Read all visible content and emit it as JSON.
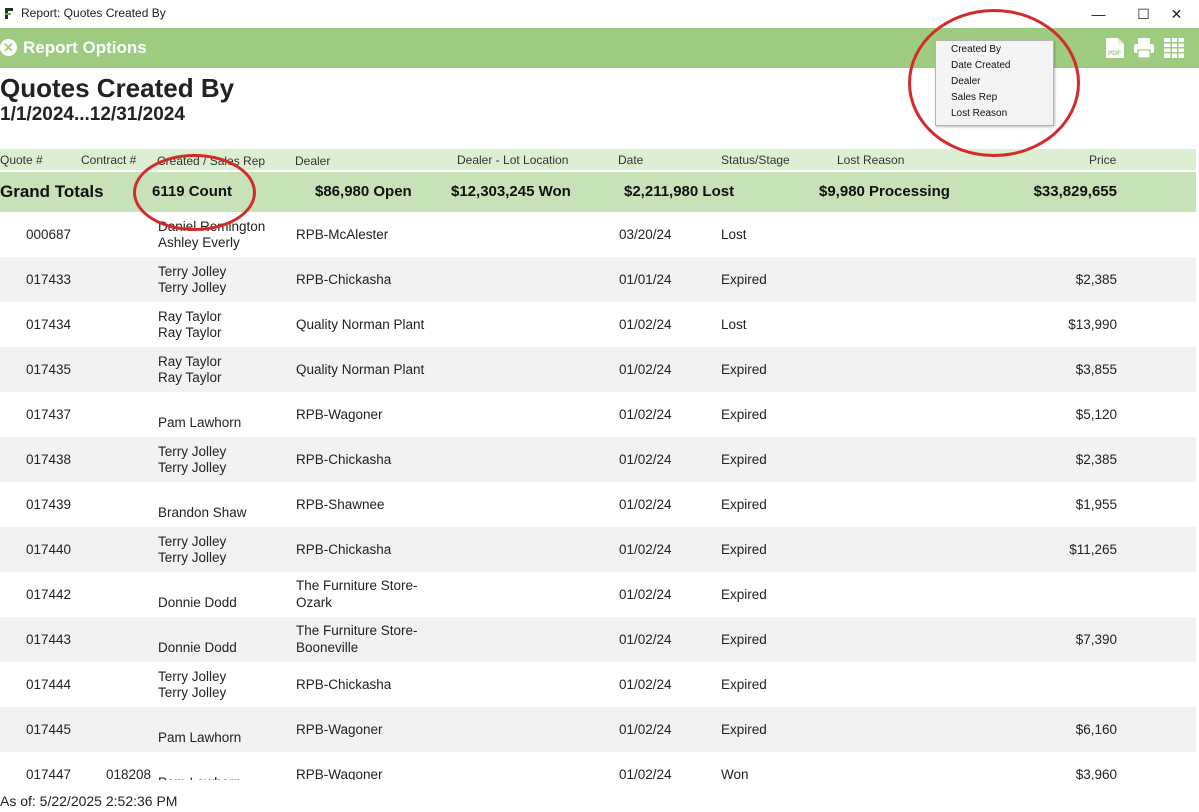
{
  "window": {
    "title": "Report: Quotes Created By",
    "minimize_glyph": "—",
    "maximize_glyph": "☐",
    "close_glyph": "✕"
  },
  "ribbon": {
    "close_glyph": "✕",
    "label": "Report Options",
    "icons": [
      "pdf-icon",
      "print-icon",
      "grid-icon"
    ],
    "pdf_text": "PDF"
  },
  "report": {
    "title": "Quotes Created By",
    "date_range": "1/1/2024...12/31/2024"
  },
  "columns": {
    "quote": "Quote #",
    "contract": "Contract #",
    "created": "Created / Sales Rep",
    "dealer": "Dealer",
    "lot": "Dealer - Lot Location",
    "date": "Date",
    "status": "Status/Stage",
    "lost": "Lost Reason",
    "price": "Price"
  },
  "totals": {
    "label": "Grand Totals",
    "count": "6119 Count",
    "open": "$86,980 Open",
    "won": "$12,303,245 Won",
    "lost": "$2,211,980  Lost",
    "processing": "$9,980 Processing",
    "price": "$33,829,655"
  },
  "rows": [
    {
      "quote": "000687",
      "contract": "",
      "created": "Daniel Remington",
      "rep": "Ashley Everly",
      "dealer": "RPB-McAlester",
      "dealer2": "",
      "date": "03/20/24",
      "status": "Lost",
      "price": ""
    },
    {
      "quote": "017433",
      "contract": "",
      "created": "Terry  Jolley",
      "rep": "Terry  Jolley",
      "dealer": "RPB-Chickasha",
      "dealer2": "",
      "date": "01/01/24",
      "status": "Expired",
      "price": "$2,385"
    },
    {
      "quote": "017434",
      "contract": "",
      "created": "Ray Taylor",
      "rep": "Ray Taylor",
      "dealer": "Quality Norman Plant",
      "dealer2": "",
      "date": "01/02/24",
      "status": "Lost",
      "price": "$13,990"
    },
    {
      "quote": "017435",
      "contract": "",
      "created": "Ray Taylor",
      "rep": "Ray Taylor",
      "dealer": "Quality Norman Plant",
      "dealer2": "",
      "date": "01/02/24",
      "status": "Expired",
      "price": "$3,855"
    },
    {
      "quote": "017437",
      "contract": "",
      "created": "",
      "rep": "Pam Lawhorn",
      "dealer": "RPB-Wagoner",
      "dealer2": "",
      "date": "01/02/24",
      "status": "Expired",
      "price": "$5,120"
    },
    {
      "quote": "017438",
      "contract": "",
      "created": "Terry  Jolley",
      "rep": "Terry  Jolley",
      "dealer": "RPB-Chickasha",
      "dealer2": "",
      "date": "01/02/24",
      "status": "Expired",
      "price": "$2,385"
    },
    {
      "quote": "017439",
      "contract": "",
      "created": "",
      "rep": "Brandon Shaw",
      "dealer": "RPB-Shawnee",
      "dealer2": "",
      "date": "01/02/24",
      "status": "Expired",
      "price": "$1,955"
    },
    {
      "quote": "017440",
      "contract": "",
      "created": "Terry  Jolley",
      "rep": "Terry  Jolley",
      "dealer": "RPB-Chickasha",
      "dealer2": "",
      "date": "01/02/24",
      "status": "Expired",
      "price": "$11,265"
    },
    {
      "quote": "017442",
      "contract": "",
      "created": "",
      "rep": "Donnie Dodd",
      "dealer": "The Furniture Store-",
      "dealer2": "Ozark",
      "date": "01/02/24",
      "status": "Expired",
      "price": ""
    },
    {
      "quote": "017443",
      "contract": "",
      "created": "",
      "rep": "Donnie Dodd",
      "dealer": "The Furniture Store-",
      "dealer2": "Booneville",
      "date": "01/02/24",
      "status": "Expired",
      "price": "$7,390"
    },
    {
      "quote": "017444",
      "contract": "",
      "created": "Terry  Jolley",
      "rep": "Terry  Jolley",
      "dealer": "RPB-Chickasha",
      "dealer2": "",
      "date": "01/02/24",
      "status": "Expired",
      "price": ""
    },
    {
      "quote": "017445",
      "contract": "",
      "created": "",
      "rep": "Pam Lawhorn",
      "dealer": "RPB-Wagoner",
      "dealer2": "",
      "date": "01/02/24",
      "status": "Expired",
      "price": "$6,160"
    },
    {
      "quote": "017447",
      "contract": "018208",
      "created": "",
      "rep": "Pam Lawhorn",
      "dealer": "RPB-Wagoner",
      "dealer2": "",
      "date": "01/02/24",
      "status": "Won",
      "price": "$3,960"
    }
  ],
  "footer": {
    "as_of": "As of: 5/22/2025 2:52:36 PM"
  },
  "group_menu": {
    "items": [
      "Created By",
      "Date Created",
      "Dealer",
      "Sales Rep",
      "Lost Reason"
    ]
  },
  "colors": {
    "ribbon": "#9dcc80",
    "header_row": "#dcefd2",
    "totals_row": "#c7e2b7",
    "annotation": "#d42a2a"
  }
}
